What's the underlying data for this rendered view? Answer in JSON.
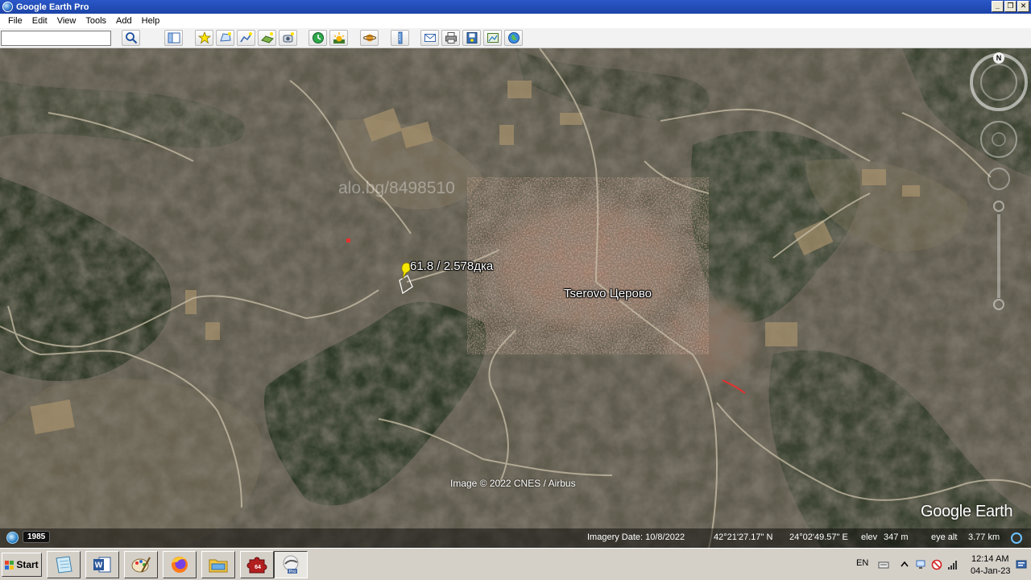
{
  "window": {
    "title": "Google Earth Pro",
    "minimize_glyph": "_",
    "restore_glyph": "❐",
    "close_glyph": "✕"
  },
  "menu": [
    "File",
    "Edit",
    "View",
    "Tools",
    "Add",
    "Help"
  ],
  "search": {
    "value": "",
    "placeholder": ""
  },
  "toolbar_icons": [
    "search-icon",
    "sidebar-icon",
    "placemark-icon",
    "polygon-icon",
    "path-icon",
    "overlay-icon",
    "tour-icon",
    "history-icon",
    "sunlight-icon",
    "planet-icon",
    "ruler-icon",
    "email-icon",
    "print-icon",
    "save-image-icon",
    "maps-icon",
    "earth-icon"
  ],
  "map": {
    "placemark_label": "61.8 / 2.578дка",
    "place_label": "Tserovo Церово",
    "watermark": "alo.bg/8498510",
    "imagery_credit": "Image © 2022 CNES / Airbus",
    "logo": "Google Earth",
    "compass_north": "N"
  },
  "status": {
    "year": "1985",
    "imagery_date": "Imagery Date: 10/8/2022",
    "latitude": "42°21'27.17\" N",
    "longitude": "24°02'49.57\" E",
    "elev_label": "elev",
    "elev_value": "347 m",
    "eye_alt_label": "eye alt",
    "eye_alt_value": "3.77 km"
  },
  "taskbar": {
    "start_label": "Start",
    "apps": [
      "notepad-icon",
      "word-icon",
      "paint-icon",
      "firefox-icon",
      "explorer-icon",
      "puzzle-icon",
      "google-earth-icon"
    ],
    "puzzle_badge": "64",
    "pro_badge": "Pro",
    "language": "EN",
    "time": "12:14 AM",
    "date": "04-Jan-23"
  },
  "colors": {
    "title_bar": "#1c44a8",
    "placemark": "#f5e800",
    "accent": "#6ec3ff"
  }
}
